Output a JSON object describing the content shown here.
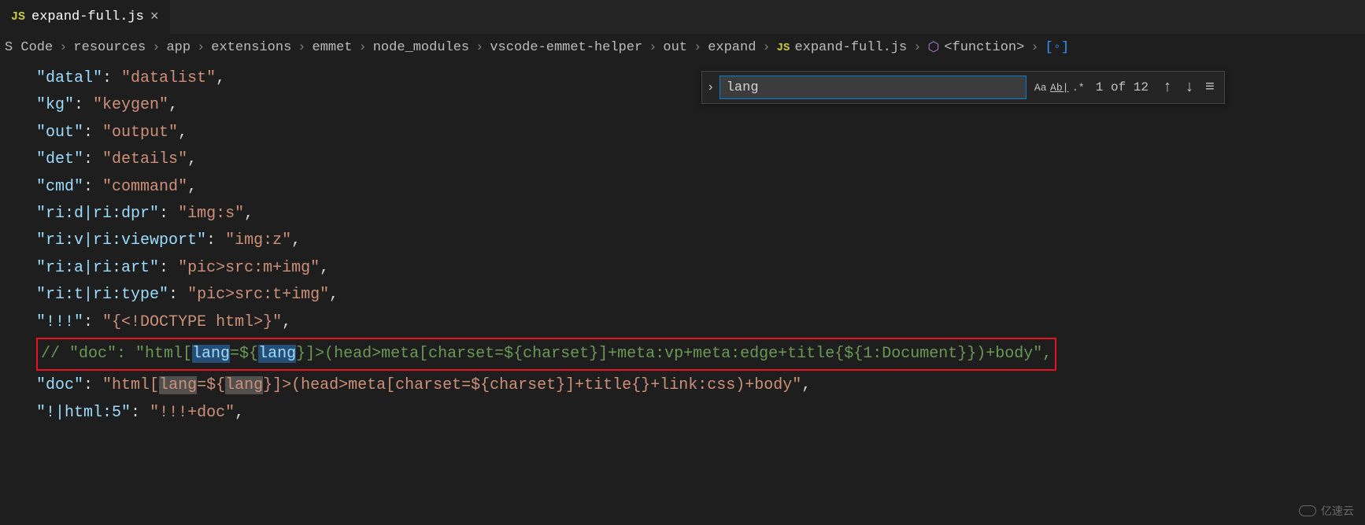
{
  "tab": {
    "icon_text": "JS",
    "filename": "expand-full.js",
    "close_glyph": "×"
  },
  "breadcrumb": {
    "sep": "›",
    "parts": [
      "S Code",
      "resources",
      "app",
      "extensions",
      "emmet",
      "node_modules",
      "vscode-emmet-helper",
      "out",
      "expand"
    ],
    "file_icon": "JS",
    "file": "expand-full.js",
    "fn_label": "<function>"
  },
  "find": {
    "expand_glyph": "›",
    "value": "lang",
    "opt_case": "Aa",
    "opt_word": "Ab|",
    "opt_regex": ".*",
    "count": "1 of 12",
    "up": "↑",
    "down": "↓",
    "menu": "≡"
  },
  "code_lines": [
    "\"datal\": \"datalist\",",
    "\"kg\": \"keygen\",",
    "\"out\": \"output\",",
    "\"det\": \"details\",",
    "\"cmd\": \"command\",",
    "",
    "\"ri:d|ri:dpr\": \"img:s\",",
    "\"ri:v|ri:viewport\": \"img:z\",",
    "\"ri:a|ri:art\": \"pic>src:m+img\",",
    "\"ri:t|ri:type\": \"pic>src:t+img\",",
    "",
    "\"!!!\": \"{<!DOCTYPE html>}\",",
    "// \"doc\": \"html[lang=${lang}]>(head>meta[charset=${charset}]+meta:vp+meta:edge+title{${1:Document}})+body\",",
    "\"doc\": \"html[lang=${lang}]>(head>meta[charset=${charset}]+title{}+link:css)+body\",",
    "\"!|html:5\": \"!!!+doc\","
  ],
  "watermark": {
    "text": "亿速云"
  }
}
